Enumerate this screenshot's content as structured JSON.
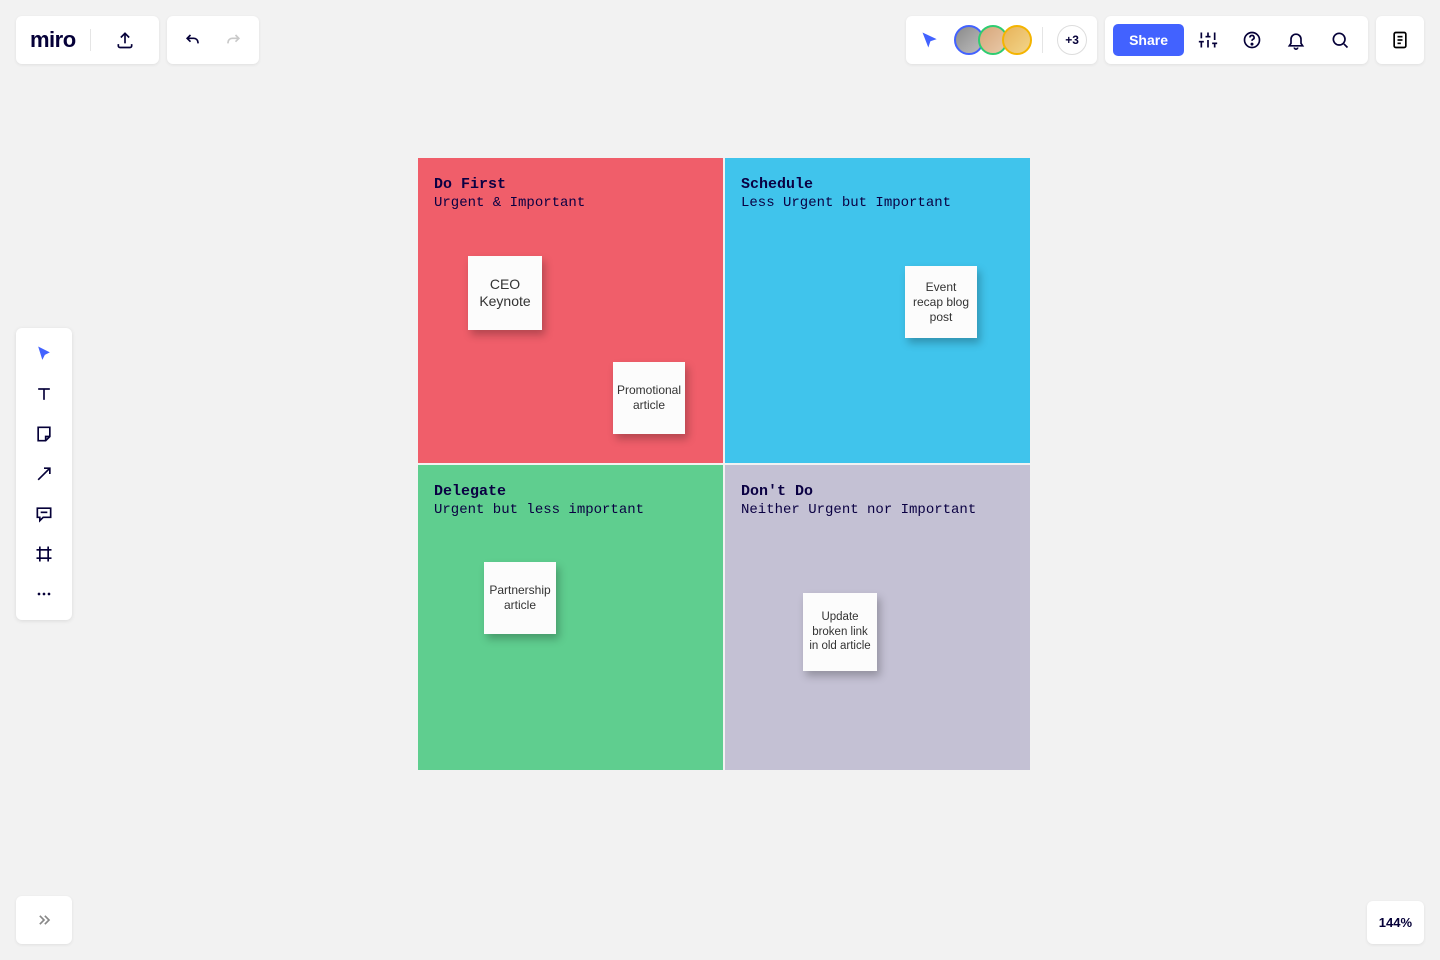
{
  "app": {
    "name": "miro"
  },
  "header": {
    "avatar_overflow": "+3",
    "share_label": "Share"
  },
  "zoom": {
    "level": "144%"
  },
  "matrix": {
    "do_first": {
      "title": "Do First",
      "subtitle": "Urgent & Important"
    },
    "schedule": {
      "title": "Schedule",
      "subtitle": "Less Urgent but Important"
    },
    "delegate": {
      "title": "Delegate",
      "subtitle": "Urgent but less important"
    },
    "dont_do": {
      "title": "Don't Do",
      "subtitle": "Neither Urgent nor Important"
    }
  },
  "stickies": {
    "ceo_keynote": "CEO Keynote",
    "promotional": "Promotional article",
    "event_recap": "Event recap blog post",
    "partnership": "Partnership article",
    "broken_link": "Update broken link in old article"
  }
}
